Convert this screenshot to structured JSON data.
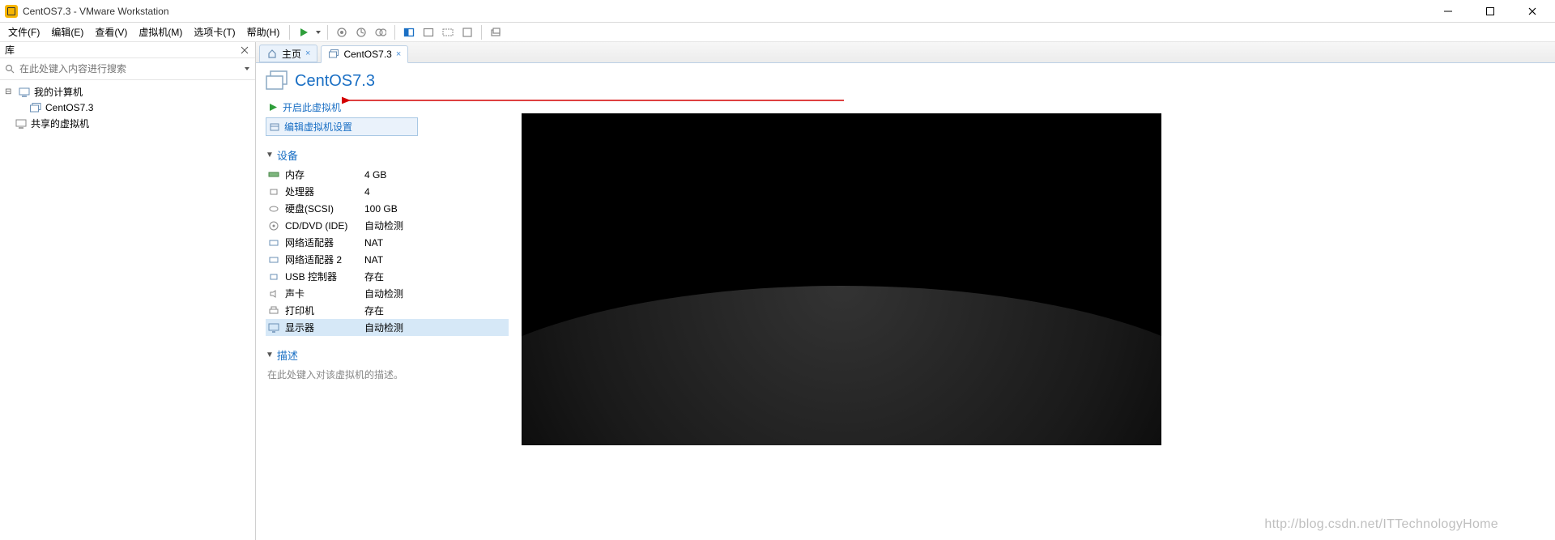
{
  "window": {
    "title": "CentOS7.3 - VMware Workstation"
  },
  "menu": {
    "items": [
      "文件(F)",
      "编辑(E)",
      "查看(V)",
      "虚拟机(M)",
      "选项卡(T)",
      "帮助(H)"
    ]
  },
  "sidebar": {
    "title": "库",
    "search_placeholder": "在此处键入内容进行搜索",
    "nodes": {
      "mycomputer": "我的计算机",
      "vm": "CentOS7.3",
      "shared": "共享的虚拟机"
    }
  },
  "tabs": {
    "home": "主页",
    "vm": "CentOS7.3"
  },
  "vm": {
    "title": "CentOS7.3",
    "actions": {
      "poweron": "开启此虚拟机",
      "editsettings": "编辑虚拟机设置"
    },
    "sections": {
      "devices": "设备",
      "description": "描述"
    },
    "devices": [
      {
        "label": "内存",
        "value": "4 GB"
      },
      {
        "label": "处理器",
        "value": "4"
      },
      {
        "label": "硬盘(SCSI)",
        "value": "100 GB"
      },
      {
        "label": "CD/DVD (IDE)",
        "value": "自动检测"
      },
      {
        "label": "网络适配器",
        "value": "NAT"
      },
      {
        "label": "网络适配器 2",
        "value": "NAT"
      },
      {
        "label": "USB 控制器",
        "value": "存在"
      },
      {
        "label": "声卡",
        "value": "自动检测"
      },
      {
        "label": "打印机",
        "value": "存在"
      },
      {
        "label": "显示器",
        "value": "自动检测"
      }
    ],
    "description_placeholder": "在此处键入对该虚拟机的描述。"
  },
  "watermark": "http://blog.csdn.net/ITTechnologyHome"
}
